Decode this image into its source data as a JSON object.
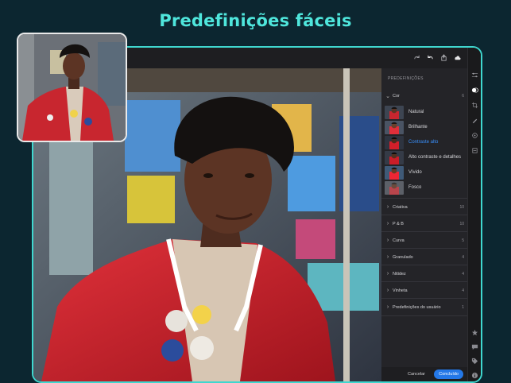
{
  "headline": "Predefinições fáceis",
  "toolbar": {
    "icons": [
      "redo-icon",
      "undo-icon",
      "share-icon",
      "cloud-sync-icon",
      "more-icon"
    ]
  },
  "panel": {
    "title": "PREDEFINIÇÕES",
    "open_group": {
      "label": "Cor",
      "count": "6"
    },
    "presets": [
      {
        "label": "Natural",
        "selected": false
      },
      {
        "label": "Brilhante",
        "selected": false
      },
      {
        "label": "Contraste alto",
        "selected": true
      },
      {
        "label": "Alto contraste e detalhes",
        "selected": false
      },
      {
        "label": "Vívido",
        "selected": false
      },
      {
        "label": "Fosco",
        "selected": false
      }
    ],
    "groups": [
      {
        "label": "Criativa",
        "count": "10"
      },
      {
        "label": "P & B",
        "count": "10"
      },
      {
        "label": "Curva",
        "count": "5"
      },
      {
        "label": "Granulado",
        "count": "4"
      },
      {
        "label": "Nitidez",
        "count": "4"
      },
      {
        "label": "Vinheta",
        "count": "4"
      },
      {
        "label": "Predefinições do usuário",
        "count": "1"
      }
    ],
    "cancel_label": "Cancelar",
    "done_label": "Concluído"
  },
  "rail": {
    "top_icons": [
      "sliders-icon",
      "presets-icon",
      "crop-icon",
      "brush-icon",
      "selective-icon",
      "versions-icon"
    ],
    "bottom_icons": [
      "star-icon",
      "comment-icon",
      "tag-icon",
      "info-icon"
    ]
  },
  "colors": {
    "accent_teal": "#4fe6dc",
    "selected_blue": "#3a92ff",
    "done_button": "#2478e8",
    "jacket_red": "#c4202a"
  }
}
